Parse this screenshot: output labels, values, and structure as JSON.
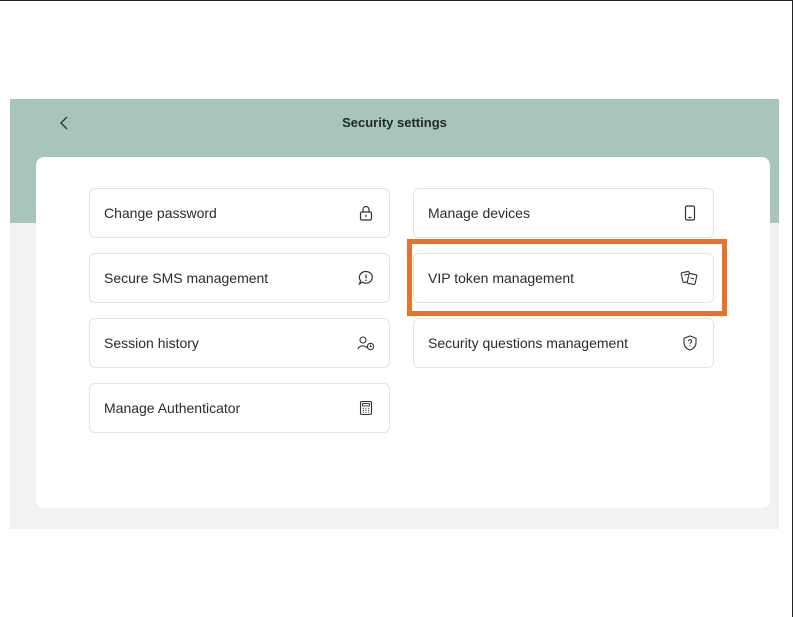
{
  "header": {
    "title": "Security settings",
    "back_icon": "chevron-left-icon"
  },
  "options": [
    {
      "label": "Change password",
      "icon": "lock-icon"
    },
    {
      "label": "Manage devices",
      "icon": "phone-icon"
    },
    {
      "label": "Secure SMS management",
      "icon": "sms-alert-icon"
    },
    {
      "label": "VIP token management",
      "icon": "token-icon"
    },
    {
      "label": "Session history",
      "icon": "user-clock-icon"
    },
    {
      "label": "Security questions management",
      "icon": "shield-question-icon"
    },
    {
      "label": "Manage Authenticator",
      "icon": "calculator-icon"
    }
  ],
  "colors": {
    "header_bg": "#a7c5bb",
    "highlight": "#e8712e",
    "page_bg": "#f2f2f4"
  }
}
